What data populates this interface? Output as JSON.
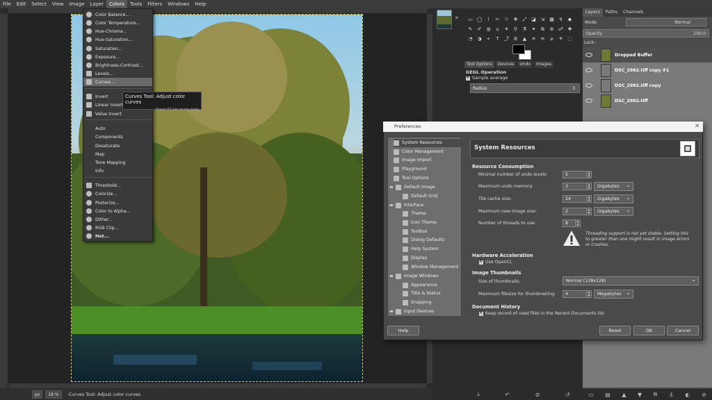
{
  "menubar": {
    "items": [
      "File",
      "Edit",
      "Select",
      "View",
      "Image",
      "Layer",
      "Colors",
      "Tools",
      "Filters",
      "Windows",
      "Help"
    ],
    "active": "Colors"
  },
  "colors_menu": {
    "items": [
      "Color Balance...",
      "Color Temperature...",
      "Hue-Chroma...",
      "Hue-Saturation...",
      "Saturation...",
      "Exposure...",
      "Brightness-Contrast...",
      "Levels...",
      "Curves...",
      "Invert",
      "Linear Invert",
      "Value Invert",
      "Auto",
      "Components",
      "Desaturate",
      "Map",
      "Tone Mapping",
      "Info",
      "Threshold...",
      "Colorize...",
      "Posterize...",
      "Color to Alpha...",
      "Dither...",
      "RGB Clip...",
      "Hot..."
    ],
    "highlighted": "Curves..."
  },
  "tooltip": {
    "title": "Curves Tool: Adjust color curves",
    "hint": "Press F1 for more help"
  },
  "statusbar": {
    "unit": "px",
    "zoom": "18 %",
    "message": "Curves Tool: Adjust color curves"
  },
  "tool_options": {
    "tabs": [
      "Tool Options",
      "Devices",
      "Undo",
      "Images"
    ],
    "title": "GEGL Operation",
    "sample_average_label": "Sample average",
    "radius_label": "Radius",
    "radius_value": "3"
  },
  "layers": {
    "tabs": [
      "Layers",
      "Paths",
      "Channels"
    ],
    "mode_label": "Mode",
    "mode_value": "Normal",
    "opacity_label": "Opacity",
    "opacity_value": "100.0",
    "lock_label": "Lock:",
    "list": [
      "Dropped Buffer",
      "DSC_2982.tiff copy #1",
      "DSC_2982.tiff copy",
      "DSC_2982.tiff"
    ]
  },
  "preferences": {
    "title": "Preferences",
    "tree": [
      "System Resources",
      "Color Management",
      "Image Import",
      "Playground",
      "Tool Options",
      "Default Image",
      "Default Grid",
      "Interface",
      "Theme",
      "Icon Theme",
      "Toolbox",
      "Dialog Defaults",
      "Help System",
      "Display",
      "Window Management",
      "Image Windows",
      "Appearance",
      "Title & Status",
      "Snapping",
      "Input Devices"
    ],
    "header": "System Resources",
    "resource_consumption": {
      "title": "Resource Consumption",
      "undo_levels_label": "Minimal number of undo levels:",
      "undo_levels_value": "5",
      "undo_memory_label": "Maximum undo memory:",
      "undo_memory_value": "3",
      "undo_memory_unit": "Gigabytes",
      "tile_cache_label": "Tile cache size:",
      "tile_cache_value": "24",
      "tile_cache_unit": "Gigabytes",
      "max_image_label": "Maximum new image size:",
      "max_image_value": "2",
      "max_image_unit": "Gigabytes",
      "threads_label": "Number of threads to use:",
      "threads_value": "8",
      "warning": "Threading support is not yet stable. Setting this to greater than one might result in image errors or crashes."
    },
    "hardware_acceleration": {
      "title": "Hardware Acceleration",
      "opencl_label": "Use OpenCL"
    },
    "image_thumbnails": {
      "title": "Image Thumbnails",
      "size_label": "Size of thumbnails:",
      "size_value": "Normal (128x128)",
      "filesize_label": "Maximum filesize for thumbnailing:",
      "filesize_value": "4",
      "filesize_unit": "Megabytes"
    },
    "document_history": {
      "title": "Document History",
      "keep_record_label": "Keep record of used files in the Recent Documents list"
    },
    "buttons": {
      "help": "Help",
      "reset": "Reset",
      "ok": "OK",
      "cancel": "Cancel"
    }
  }
}
